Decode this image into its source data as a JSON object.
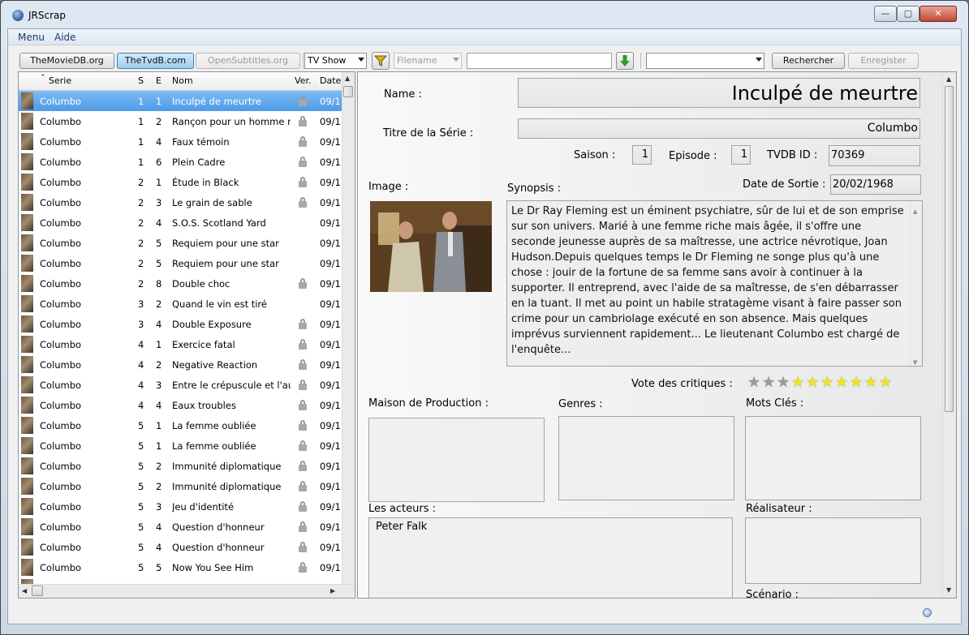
{
  "window": {
    "title": "JRScrap",
    "min_glyph": "—",
    "max_glyph": "▢",
    "close_glyph": "✕"
  },
  "menu": {
    "items": [
      "Menu",
      "Aide"
    ]
  },
  "toolbar": {
    "tmdb_label": "TheMovieDB.org",
    "tvdb_label": "TheTvdB.com",
    "opensubs_label": "OpenSubtitles.org",
    "type_select": "TV Show",
    "filter_select": "Filename",
    "search_value": "",
    "search_select": "",
    "search_label": "Rechercher",
    "save_label": "Enregister"
  },
  "list": {
    "headers": {
      "serie": "Serie",
      "s": "S",
      "e": "E",
      "nom": "Nom",
      "ver": "Ver.",
      "date": "Date"
    },
    "sort_glyph": "ˇ",
    "rows": [
      {
        "serie": "Columbo",
        "s": "1",
        "e": "1",
        "nom": "Inculpé de meurtre",
        "locked": true,
        "date": "09/1",
        "selected": true
      },
      {
        "serie": "Columbo",
        "s": "1",
        "e": "2",
        "nom": "Rançon pour un homme mort",
        "locked": true,
        "date": "09/1"
      },
      {
        "serie": "Columbo",
        "s": "1",
        "e": "4",
        "nom": "Faux témoin",
        "locked": true,
        "date": "09/1"
      },
      {
        "serie": "Columbo",
        "s": "1",
        "e": "6",
        "nom": "Plein Cadre",
        "locked": true,
        "date": "09/1"
      },
      {
        "serie": "Columbo",
        "s": "2",
        "e": "1",
        "nom": "Étude in Black",
        "locked": true,
        "date": "09/1"
      },
      {
        "serie": "Columbo",
        "s": "2",
        "e": "3",
        "nom": "Le grain de sable",
        "locked": true,
        "date": "09/1"
      },
      {
        "serie": "Columbo",
        "s": "2",
        "e": "4",
        "nom": "S.O.S. Scotland Yard",
        "locked": false,
        "date": "09/1"
      },
      {
        "serie": "Columbo",
        "s": "2",
        "e": "5",
        "nom": "Requiem pour une star",
        "locked": false,
        "date": "09/1"
      },
      {
        "serie": "Columbo",
        "s": "2",
        "e": "5",
        "nom": "Requiem pour une star",
        "locked": false,
        "date": "09/1"
      },
      {
        "serie": "Columbo",
        "s": "2",
        "e": "8",
        "nom": "Double choc",
        "locked": true,
        "date": "09/1"
      },
      {
        "serie": "Columbo",
        "s": "3",
        "e": "2",
        "nom": "Quand le vin est tiré",
        "locked": false,
        "date": "09/1"
      },
      {
        "serie": "Columbo",
        "s": "3",
        "e": "4",
        "nom": "Double Exposure",
        "locked": true,
        "date": "09/1"
      },
      {
        "serie": "Columbo",
        "s": "4",
        "e": "1",
        "nom": "Exercice fatal",
        "locked": true,
        "date": "09/1"
      },
      {
        "serie": "Columbo",
        "s": "4",
        "e": "2",
        "nom": "Negative Reaction",
        "locked": true,
        "date": "09/1"
      },
      {
        "serie": "Columbo",
        "s": "4",
        "e": "3",
        "nom": "Entre le crépuscule et l'aube",
        "locked": true,
        "date": "09/1"
      },
      {
        "serie": "Columbo",
        "s": "4",
        "e": "4",
        "nom": "Eaux troubles",
        "locked": true,
        "date": "09/1"
      },
      {
        "serie": "Columbo",
        "s": "5",
        "e": "1",
        "nom": "La femme oubliée",
        "locked": true,
        "date": "09/1"
      },
      {
        "serie": "Columbo",
        "s": "5",
        "e": "1",
        "nom": "La femme oubliée",
        "locked": true,
        "date": "09/1"
      },
      {
        "serie": "Columbo",
        "s": "5",
        "e": "2",
        "nom": "Immunité diplomatique",
        "locked": true,
        "date": "09/1"
      },
      {
        "serie": "Columbo",
        "s": "5",
        "e": "2",
        "nom": "Immunité diplomatique",
        "locked": true,
        "date": "09/1"
      },
      {
        "serie": "Columbo",
        "s": "5",
        "e": "3",
        "nom": "Jeu d'identité",
        "locked": true,
        "date": "09/1"
      },
      {
        "serie": "Columbo",
        "s": "5",
        "e": "4",
        "nom": "Question d'honneur",
        "locked": true,
        "date": "09/1"
      },
      {
        "serie": "Columbo",
        "s": "5",
        "e": "4",
        "nom": "Question d'honneur",
        "locked": true,
        "date": "09/1"
      },
      {
        "serie": "Columbo",
        "s": "5",
        "e": "5",
        "nom": "Now You See Him",
        "locked": true,
        "date": "09/1"
      },
      {
        "serie": "Columbo",
        "s": "",
        "e": "",
        "nom": "",
        "locked": false,
        "date": ""
      }
    ]
  },
  "detail": {
    "name_label": "Name :",
    "name_value": "Inculpé de meurtre",
    "series_label": "Titre de la Série :",
    "series_value": "Columbo",
    "season_label": "Saison :",
    "season_value": "1",
    "episode_label": "Episode :",
    "episode_value": "1",
    "tvdb_label": "TVDB ID :",
    "tvdb_value": "70369",
    "release_label": "Date de Sortie :",
    "release_value": "20/02/1968",
    "image_label": "Image :",
    "synopsis_label": "Synopsis :",
    "synopsis_text": "Le Dr Ray Fleming est un éminent psychiatre, sûr de lui et de son emprise sur son univers. Marié à une femme riche mais âgée, il s'offre une seconde jeunesse auprès de sa maîtresse, une actrice névrotique, Joan Hudson.Depuis quelques temps le Dr Fleming ne songe plus qu'à une chose : jouir de la fortune de sa femme sans avoir à continuer à la supporter. Il entreprend, avec l'aide de sa maîtresse, de s'en débarrasser en la tuant. Il met au point un habile stratagème visant à faire passer son crime pour un cambriolage exécuté en son absence. Mais quelques imprévus surviennent rapidement... Le lieutenant Columbo est chargé de l'enquête...",
    "rating_label": "Vote des critiques :",
    "rating": {
      "value": 7,
      "max": 10,
      "filled_color": "#f4e21c",
      "empty_color": "#9a9a9a"
    },
    "production_label": "Maison de Production :",
    "genres_label": "Genres :",
    "keywords_label": "Mots Clés :",
    "actors_label": "Les acteurs :",
    "actors_value": "Peter Falk",
    "director_label": "Réalisateur :",
    "scenario_label": "Scénario :"
  }
}
